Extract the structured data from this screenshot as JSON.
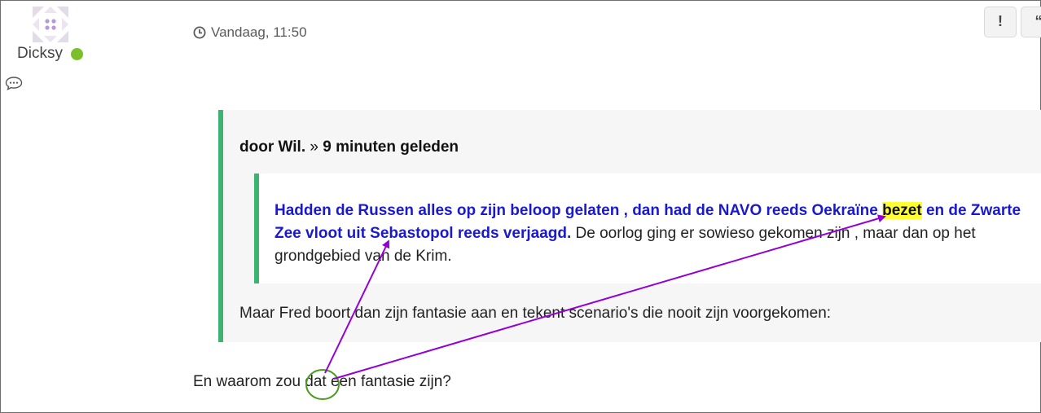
{
  "post": {
    "username": "Dicksy",
    "timestamp": "Vandaag, 11:50",
    "report_label": "!",
    "quote_label": "“"
  },
  "quote": {
    "author": "door Wil.",
    "separator": "»",
    "time_ago": "9 minuten geleden",
    "nested": {
      "bold_part_1": "Hadden de Russen alles op zijn beloop gelaten , dan had de NAVO reeds Oekraïne",
      "highlight": "bezet",
      "bold_part_2": "en de Zwarte Zee vloot uit Sebastopol reeds verjaagd.",
      "rest": "De oorlog ging er sowieso gekomen zijn , maar dan op het grondgebied van de Krim."
    },
    "text": "Maar Fred boort dan zijn fantasie aan en tekent scenario's die nooit zijn voorgekomen:"
  },
  "reply": {
    "text": "En waarom zou dat een fantasie zijn?"
  },
  "annotation": {
    "color": "#9400d3",
    "circle_color": "#4a9a1e"
  },
  "colors": {
    "quote_bar": "#3cb371",
    "online": "#7bbf2a",
    "link_blue": "#1a1acc",
    "highlight": "#ffff33"
  }
}
